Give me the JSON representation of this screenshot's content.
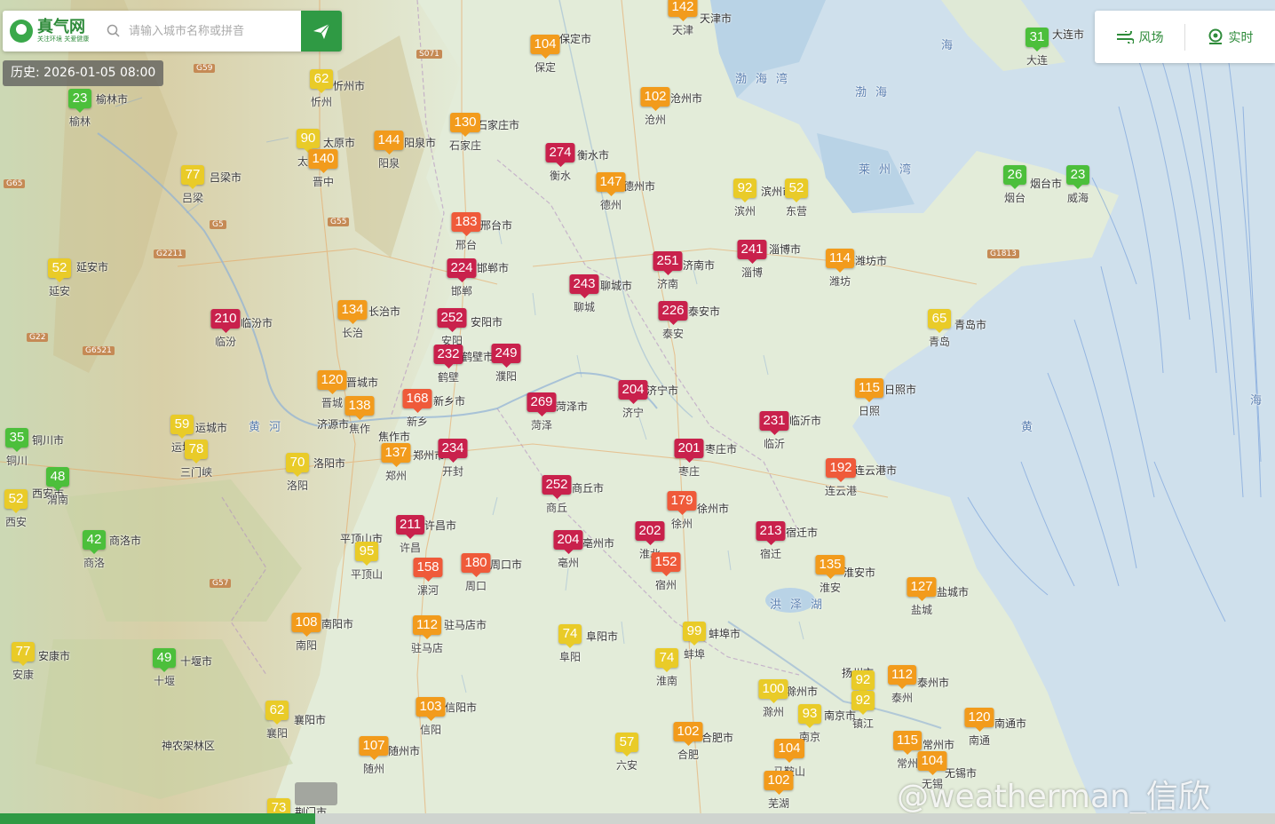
{
  "header": {
    "logo_title": "真气网",
    "logo_slogan": "关注环境 关爱健康",
    "search_placeholder": "请输入城市名称或拼音"
  },
  "history_label": "历史: 2026-01-05 08:00",
  "controls": {
    "wind_label": "风场",
    "realtime_label": "实时"
  },
  "watermark": "@weatherman_信欣",
  "colors": {
    "good": "#4cbf3b",
    "moderate": "#e9cb28",
    "light": "#f29b1c",
    "medium": "#ef5a3a",
    "heavy": "#c9214c",
    "severe": "#7e1d3b",
    "brand": "#2f9a44"
  },
  "stations": [
    {
      "aqi": "142",
      "name": "天津"
    },
    {
      "aqi": "31",
      "name": "大连"
    },
    {
      "aqi": "104",
      "name": "保定"
    },
    {
      "aqi": "62",
      "name": "忻州"
    },
    {
      "aqi": "23",
      "name": "榆林"
    },
    {
      "aqi": "102",
      "name": "沧州"
    },
    {
      "aqi": "130",
      "name": "石家庄"
    },
    {
      "aqi": "90",
      "name": "太原"
    },
    {
      "aqi": "140",
      "name": "晋中"
    },
    {
      "aqi": "144",
      "name": "阳泉"
    },
    {
      "aqi": "274",
      "name": "衡水"
    },
    {
      "aqi": "77",
      "name": "吕梁"
    },
    {
      "aqi": "147",
      "name": "德州"
    },
    {
      "aqi": "92",
      "name": "滨州"
    },
    {
      "aqi": "52",
      "name": "东营"
    },
    {
      "aqi": "26",
      "name": "烟台"
    },
    {
      "aqi": "23",
      "name": "威海"
    },
    {
      "aqi": "183",
      "name": "邢台"
    },
    {
      "aqi": "241",
      "name": "淄博"
    },
    {
      "aqi": "224",
      "name": "邯郸"
    },
    {
      "aqi": "251",
      "name": "济南"
    },
    {
      "aqi": "114",
      "name": "潍坊"
    },
    {
      "aqi": "52",
      "name": "延安"
    },
    {
      "aqi": "243",
      "name": "聊城"
    },
    {
      "aqi": "134",
      "name": "长治"
    },
    {
      "aqi": "210",
      "name": "临汾"
    },
    {
      "aqi": "252",
      "name": "安阳"
    },
    {
      "aqi": "226",
      "name": "泰安"
    },
    {
      "aqi": "65",
      "name": "青岛"
    },
    {
      "aqi": "232",
      "name": "鹤壁"
    },
    {
      "aqi": "249",
      "name": "濮阳"
    },
    {
      "aqi": "120",
      "name": "晋城"
    },
    {
      "aqi": "115",
      "name": "日照"
    },
    {
      "aqi": "168",
      "name": "新乡"
    },
    {
      "aqi": "204",
      "name": "济宁"
    },
    {
      "aqi": "138",
      "name": "焦作"
    },
    {
      "aqi": "269",
      "name": "菏泽"
    },
    {
      "aqi": "59",
      "name": "运城"
    },
    {
      "aqi": "231",
      "name": "临沂"
    },
    {
      "aqi": "35",
      "name": "铜川"
    },
    {
      "aqi": "78",
      "name": "三门峡"
    },
    {
      "aqi": "137",
      "name": "郑州"
    },
    {
      "aqi": "234",
      "name": "开封"
    },
    {
      "aqi": "201",
      "name": "枣庄"
    },
    {
      "aqi": "70",
      "name": "洛阳"
    },
    {
      "aqi": "192",
      "name": "连云港"
    },
    {
      "aqi": "48",
      "name": "渭南"
    },
    {
      "aqi": "252",
      "name": "商丘"
    },
    {
      "aqi": "52",
      "name": "西安"
    },
    {
      "aqi": "179",
      "name": "徐州"
    },
    {
      "aqi": "211",
      "name": "许昌"
    },
    {
      "aqi": "202",
      "name": "淮北"
    },
    {
      "aqi": "213",
      "name": "宿迁"
    },
    {
      "aqi": "42",
      "name": "商洛"
    },
    {
      "aqi": "95",
      "name": "平顶山"
    },
    {
      "aqi": "204",
      "name": "亳州"
    },
    {
      "aqi": "158",
      "name": "漯河"
    },
    {
      "aqi": "180",
      "name": "周口"
    },
    {
      "aqi": "152",
      "name": "宿州"
    },
    {
      "aqi": "135",
      "name": "淮安"
    },
    {
      "aqi": "127",
      "name": "盐城"
    },
    {
      "aqi": "108",
      "name": "南阳"
    },
    {
      "aqi": "112",
      "name": "驻马店"
    },
    {
      "aqi": "74",
      "name": "阜阳"
    },
    {
      "aqi": "99",
      "name": "蚌埠"
    },
    {
      "aqi": "77",
      "name": "安康"
    },
    {
      "aqi": "49",
      "name": "十堰"
    },
    {
      "aqi": "74",
      "name": "淮南"
    },
    {
      "aqi": "92",
      "name": "扬州"
    },
    {
      "aqi": "112",
      "name": "泰州"
    },
    {
      "aqi": "100",
      "name": "滁州"
    },
    {
      "aqi": "92",
      "name": "镇江"
    },
    {
      "aqi": "62",
      "name": "襄阳"
    },
    {
      "aqi": "103",
      "name": "信阳"
    },
    {
      "aqi": "93",
      "name": "南京"
    },
    {
      "aqi": "120",
      "name": "南通"
    },
    {
      "aqi": "57",
      "name": "六安"
    },
    {
      "aqi": "102",
      "name": "合肥"
    },
    {
      "aqi": "115",
      "name": "常州"
    },
    {
      "aqi": "107",
      "name": "随州"
    },
    {
      "aqi": "104",
      "name": "马鞍山"
    },
    {
      "aqi": "104",
      "name": "无锡"
    },
    {
      "aqi": "102",
      "name": "芜湖"
    },
    {
      "aqi": "73",
      "name": "荆门"
    }
  ],
  "place_labels": [
    "天津市",
    "大连市",
    "保定市",
    "忻州市",
    "榆林市",
    "沧州市",
    "石家庄市",
    "太原市",
    "阳泉市",
    "衡水市",
    "吕梁市",
    "德州市",
    "滨州市",
    "淄博市",
    "烟台市",
    "邢台市",
    "邯郸市",
    "济南市",
    "潍坊市",
    "延安市",
    "聊城市",
    "长治市",
    "临汾市",
    "安阳市",
    "泰安市",
    "青岛市",
    "鹤壁市",
    "晋城市",
    "济源市",
    "日照市",
    "新乡市",
    "济宁市",
    "焦作市",
    "菏泽市",
    "运城市",
    "临沂市",
    "铜川市",
    "郑州市",
    "枣庄市",
    "洛阳市",
    "连云港市",
    "西安市",
    "商丘市",
    "徐州市",
    "许昌市",
    "平顶山市",
    "亳州市",
    "周口市",
    "宿迁市",
    "商洛市",
    "淮安市",
    "盐城市",
    "南阳市",
    "驻马店市",
    "阜阳市",
    "蚌埠市",
    "安康市",
    "十堰市",
    "扬州市",
    "泰州市",
    "滁州市",
    "襄阳市",
    "信阳市",
    "南京市",
    "合肥市",
    "南通市",
    "常州市",
    "随州市",
    "无锡市",
    "荆门市",
    "神农架林区"
  ],
  "water_labels": [
    "渤海湾",
    "渤海",
    "莱州湾",
    "黄",
    "海",
    "洪泽湖",
    "海",
    "黄河"
  ],
  "road_labels": [
    "G59",
    "G5",
    "G55",
    "G65",
    "G22",
    "G6521",
    "G2211",
    "G57",
    "S071",
    "G1813"
  ]
}
